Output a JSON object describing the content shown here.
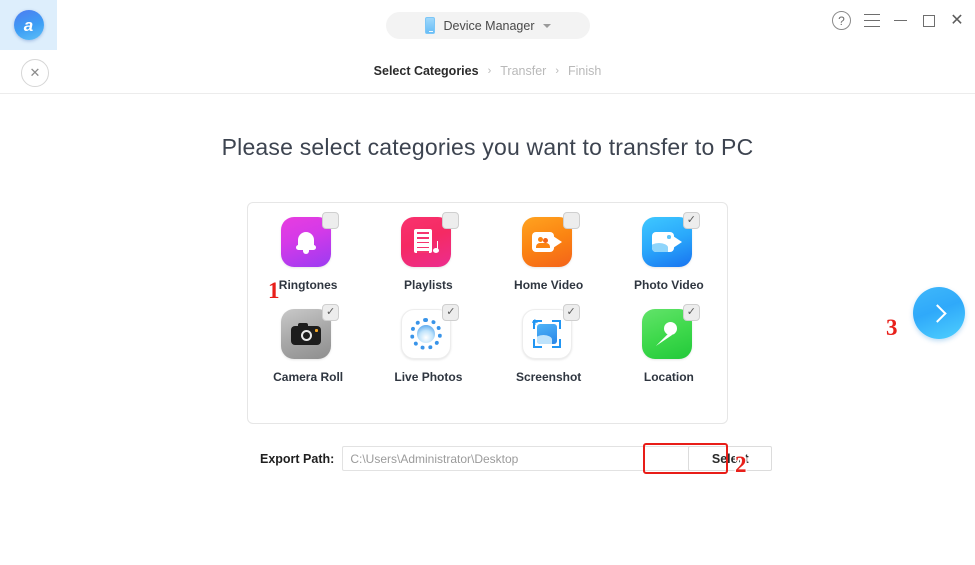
{
  "app": {
    "logo_glyph": "a",
    "logo_name": "logo-icon"
  },
  "titlebar": {
    "device_button_label": "Device Manager",
    "device_icon": "phone-icon",
    "caret_icon": "chevron-down-icon",
    "controls": {
      "help": "?",
      "menu": "hamburger-menu-icon",
      "minimize": "minimize-icon",
      "maximize": "maximize-icon",
      "close": "✕"
    }
  },
  "breadcrumb": {
    "close_label": "✕",
    "steps": [
      {
        "label": "Select Categories",
        "active": true
      },
      {
        "label": "Transfer",
        "active": false
      },
      {
        "label": "Finish",
        "active": false
      }
    ],
    "separator": "›"
  },
  "main": {
    "heading": "Please select categories you want to transfer to PC",
    "categories": [
      {
        "label": "Ringtones",
        "icon": "bell-icon",
        "checked": false,
        "check_glyph": "✓"
      },
      {
        "label": "Playlists",
        "icon": "playlist-icon",
        "checked": false,
        "check_glyph": "✓"
      },
      {
        "label": "Home Video",
        "icon": "camcorder-icon",
        "checked": false,
        "check_glyph": "✓"
      },
      {
        "label": "Photo Video",
        "icon": "photo-video-icon",
        "checked": true,
        "check_glyph": "✓"
      },
      {
        "label": "Camera Roll",
        "icon": "camera-icon",
        "checked": true,
        "check_glyph": "✓"
      },
      {
        "label": "Live Photos",
        "icon": "live-photos-icon",
        "checked": true,
        "check_glyph": "✓"
      },
      {
        "label": "Screenshot",
        "icon": "screenshot-icon",
        "checked": true,
        "check_glyph": "✓"
      },
      {
        "label": "Location",
        "icon": "location-pin-icon",
        "checked": true,
        "check_glyph": "✓"
      }
    ]
  },
  "export": {
    "label": "Export Path:",
    "value": "C:\\Users\\Administrator\\Desktop",
    "placeholder": "C:\\Users\\Administrator\\Desktop",
    "select_button": "Select"
  },
  "next": {
    "icon": "chevron-right-icon"
  },
  "annotations": [
    {
      "number": "1"
    },
    {
      "number": "2"
    },
    {
      "number": "3"
    }
  ],
  "colors": {
    "accent_blue": "#2fa9fa",
    "annotation_red": "#e8201a",
    "logo_tab_bg": "#ddeefc",
    "panel_border": "#e6e6e6"
  }
}
